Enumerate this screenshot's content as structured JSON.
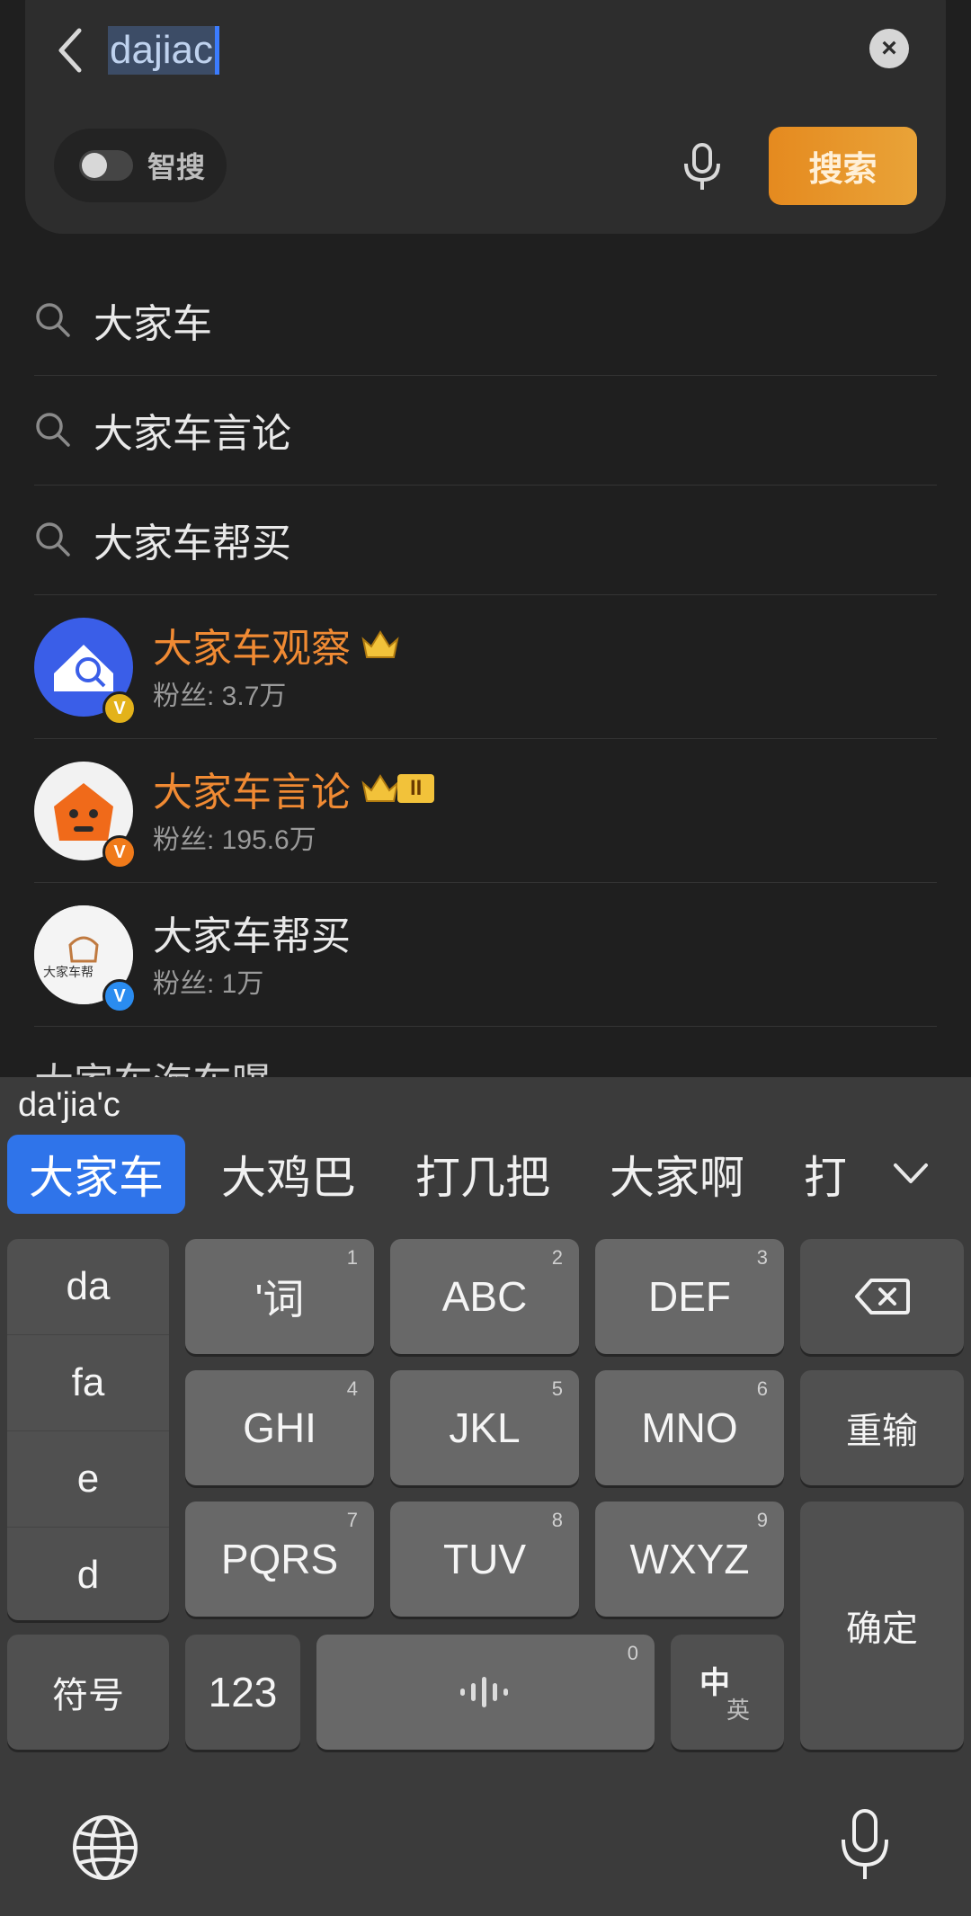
{
  "search": {
    "query": "dajiac",
    "clear_icon": "×",
    "smart_search_label": "智搜",
    "search_button_label": "搜索"
  },
  "suggestions": [
    {
      "text": "大家车"
    },
    {
      "text": "大家车言论"
    },
    {
      "text": "大家车帮买"
    }
  ],
  "users": [
    {
      "name": "大家车观察",
      "fans": "粉丝: 3.7万",
      "badge": "V",
      "badge_color": "#e3b21a",
      "name_color": "#f08a33"
    },
    {
      "name": "大家车言论",
      "fans": "粉丝: 195.6万",
      "badge": "V",
      "badge_color": "#f07a1a",
      "name_color": "#f08a33",
      "level": "II"
    },
    {
      "name": "大家车帮买",
      "fans": "粉丝: 1万",
      "badge": "V",
      "badge_color": "#2a8cf0",
      "name_color": "#e9e9e9",
      "avatar_text": "大家车帮"
    }
  ],
  "partial_row_text": "大家车海车曝",
  "keyboard": {
    "pinyin": "da'jia'c",
    "candidates": [
      "大家车",
      "大鸡巴",
      "打几把",
      "大家啊",
      "打"
    ],
    "side_items": [
      "da",
      "fa",
      "e",
      "d"
    ],
    "keys": {
      "k1": {
        "label": "'词",
        "num": "1"
      },
      "k2": {
        "label": "ABC",
        "num": "2"
      },
      "k3": {
        "label": "DEF",
        "num": "3"
      },
      "k4": {
        "label": "GHI",
        "num": "4"
      },
      "k5": {
        "label": "JKL",
        "num": "5"
      },
      "k6": {
        "label": "MNO",
        "num": "6"
      },
      "k7": {
        "label": "PQRS",
        "num": "7"
      },
      "k8": {
        "label": "TUV",
        "num": "8"
      },
      "k9": {
        "label": "WXYZ",
        "num": "9"
      },
      "space_num": "0"
    },
    "reset_label": "重输",
    "confirm_label": "确定",
    "symbols_label": "符号",
    "numbers_label": "123",
    "lang_switch_top": "中",
    "lang_switch_bottom": "英"
  }
}
